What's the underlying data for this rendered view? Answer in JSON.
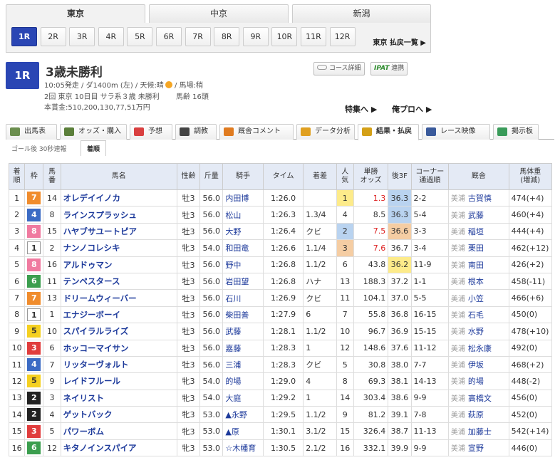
{
  "venues": [
    {
      "label": "東京",
      "active": true
    },
    {
      "label": "中京",
      "active": false
    },
    {
      "label": "新潟",
      "active": false
    }
  ],
  "race_buttons": [
    "1R",
    "2R",
    "3R",
    "4R",
    "5R",
    "6R",
    "7R",
    "8R",
    "9R",
    "10R",
    "11R",
    "12R"
  ],
  "payout_link": "東京 払戻一覧 ▶",
  "race": {
    "number": "1R",
    "title": "3歳未勝利",
    "line1a": "10:05発走 / ダ1400m (左) / 天候:晴",
    "line1b": " / 馬場:稍",
    "line2": "2回 東京 10日目 サラ系３歳 未勝利　　 馬齢 16頭",
    "line3": "本賞金:510,200,130,77,51万円"
  },
  "buttons": {
    "course": "コース詳細",
    "ipat_a": "IPAT",
    "ipat_b": "連携",
    "feature": "特集へ ▶",
    "orepro": "俺プロへ ▶"
  },
  "colors": {
    "brand": "#2a46b4",
    "header_bg": "#e4eaf5"
  },
  "nav_tabs": [
    {
      "label": "出馬表",
      "icon": "table-icon",
      "color": "#6b8e4e"
    },
    {
      "label": "オッズ・購入",
      "icon": "odds-icon",
      "color": "#5b7f3a"
    },
    {
      "label": "予想",
      "icon": "target-icon",
      "color": "#d94040"
    },
    {
      "label": "調教",
      "icon": "stopwatch-icon",
      "color": "#444444"
    },
    {
      "label": "厩舎コメント",
      "icon": "stable-icon",
      "color": "#e07b20"
    },
    {
      "label": "データ分析",
      "icon": "bar-chart-icon",
      "color": "#e0a020"
    },
    {
      "label": "結果・払戻",
      "icon": "coins-icon",
      "color": "#d4a017"
    },
    {
      "label": "レース映像",
      "icon": "video-icon",
      "color": "#3a5a9b"
    },
    {
      "label": "掲示板",
      "icon": "chat-icon",
      "color": "#3a9b5a"
    }
  ],
  "sub_tabs": {
    "goal": "ゴール後 30秒速報",
    "active": "着順"
  },
  "table": {
    "headers": [
      "着\n順",
      "枠",
      "馬\n番",
      "馬名",
      "性齢",
      "斤量",
      "騎手",
      "タイム",
      "着差",
      "人\n気",
      "単勝\nオッズ",
      "後3F",
      "コーナー\n通過順",
      "厩舎",
      "馬体重\n(増減)"
    ],
    "rows": [
      {
        "pos": "1",
        "waku": "7",
        "num": "14",
        "horse": "オレデイイノカ",
        "sex": "牡3",
        "wt": "56.0",
        "jockey": "内田博",
        "time": "1:26.0",
        "margin": "",
        "pop": "1",
        "odds": "1.3",
        "f3": "36.3",
        "corner": "2-2",
        "tr": "美浦",
        "trainer": "古賀慎",
        "bw": "474(+4)"
      },
      {
        "pos": "2",
        "waku": "4",
        "num": "8",
        "horse": "ラインスプラッシュ",
        "sex": "牡3",
        "wt": "56.0",
        "jockey": "松山",
        "time": "1:26.3",
        "margin": "1.3/4",
        "pop": "4",
        "odds": "8.5",
        "f3": "36.3",
        "corner": "5-4",
        "tr": "美浦",
        "trainer": "武藤",
        "bw": "460(+4)"
      },
      {
        "pos": "3",
        "waku": "8",
        "num": "15",
        "horse": "ハヤブサユートピア",
        "sex": "牡3",
        "wt": "56.0",
        "jockey": "大野",
        "time": "1:26.4",
        "margin": "クビ",
        "pop": "2",
        "odds": "7.5",
        "f3": "36.6",
        "corner": "3-3",
        "tr": "美浦",
        "trainer": "稲垣",
        "bw": "444(+4)"
      },
      {
        "pos": "4",
        "waku": "1",
        "num": "2",
        "horse": "ナンノコレシキ",
        "sex": "牝3",
        "wt": "54.0",
        "jockey": "和田竜",
        "time": "1:26.6",
        "margin": "1.1/4",
        "pop": "3",
        "odds": "7.6",
        "f3": "36.7",
        "corner": "3-4",
        "tr": "美浦",
        "trainer": "栗田",
        "bw": "462(+12)"
      },
      {
        "pos": "5",
        "waku": "8",
        "num": "16",
        "horse": "アルドゥマン",
        "sex": "牡3",
        "wt": "56.0",
        "jockey": "野中",
        "time": "1:26.8",
        "margin": "1.1/2",
        "pop": "6",
        "odds": "43.8",
        "f3": "36.2",
        "corner": "11-9",
        "tr": "美浦",
        "trainer": "南田",
        "bw": "426(+2)"
      },
      {
        "pos": "6",
        "waku": "6",
        "num": "11",
        "horse": "テンペスタース",
        "sex": "牡3",
        "wt": "56.0",
        "jockey": "岩田望",
        "time": "1:26.8",
        "margin": "ハナ",
        "pop": "13",
        "odds": "188.3",
        "f3": "37.2",
        "corner": "1-1",
        "tr": "美浦",
        "trainer": "根本",
        "bw": "458(-11)"
      },
      {
        "pos": "7",
        "waku": "7",
        "num": "13",
        "horse": "ドリームウィーバー",
        "sex": "牡3",
        "wt": "56.0",
        "jockey": "石川",
        "time": "1:26.9",
        "margin": "クビ",
        "pop": "11",
        "odds": "104.1",
        "f3": "37.0",
        "corner": "5-5",
        "tr": "美浦",
        "trainer": "小笠",
        "bw": "466(+6)"
      },
      {
        "pos": "8",
        "waku": "1",
        "num": "1",
        "horse": "エナジーボーイ",
        "sex": "牡3",
        "wt": "56.0",
        "jockey": "柴田善",
        "time": "1:27.9",
        "margin": "6",
        "pop": "7",
        "odds": "55.8",
        "f3": "36.8",
        "corner": "16-15",
        "tr": "美浦",
        "trainer": "石毛",
        "bw": "450(0)"
      },
      {
        "pos": "9",
        "waku": "5",
        "num": "10",
        "horse": "スパイラルライズ",
        "sex": "牡3",
        "wt": "56.0",
        "jockey": "武藤",
        "time": "1:28.1",
        "margin": "1.1/2",
        "pop": "10",
        "odds": "96.7",
        "f3": "36.9",
        "corner": "15-15",
        "tr": "美浦",
        "trainer": "水野",
        "bw": "478(+10)"
      },
      {
        "pos": "10",
        "waku": "3",
        "num": "6",
        "horse": "ホッコーマイサン",
        "sex": "牡3",
        "wt": "56.0",
        "jockey": "嘉藤",
        "time": "1:28.3",
        "margin": "1",
        "pop": "12",
        "odds": "148.6",
        "f3": "37.6",
        "corner": "11-12",
        "tr": "美浦",
        "trainer": "松永康",
        "bw": "492(0)"
      },
      {
        "pos": "11",
        "waku": "4",
        "num": "7",
        "horse": "リッターヴォルト",
        "sex": "牡3",
        "wt": "56.0",
        "jockey": "三浦",
        "time": "1:28.3",
        "margin": "クビ",
        "pop": "5",
        "odds": "30.8",
        "f3": "38.0",
        "corner": "7-7",
        "tr": "美浦",
        "trainer": "伊坂",
        "bw": "468(+2)"
      },
      {
        "pos": "12",
        "waku": "5",
        "num": "9",
        "horse": "レイドフルール",
        "sex": "牝3",
        "wt": "54.0",
        "jockey": "的場",
        "time": "1:29.0",
        "margin": "4",
        "pop": "8",
        "odds": "69.3",
        "f3": "38.1",
        "corner": "14-13",
        "tr": "美浦",
        "trainer": "的場",
        "bw": "448(-2)"
      },
      {
        "pos": "13",
        "waku": "2",
        "num": "3",
        "horse": "ネイリスト",
        "sex": "牝3",
        "wt": "54.0",
        "jockey": "大庭",
        "time": "1:29.2",
        "margin": "1",
        "pop": "14",
        "odds": "303.4",
        "f3": "38.6",
        "corner": "9-9",
        "tr": "美浦",
        "trainer": "高橋文",
        "bw": "456(0)"
      },
      {
        "pos": "14",
        "waku": "2",
        "num": "4",
        "horse": "ゲットバック",
        "sex": "牝3",
        "wt": "53.0",
        "jockey": "▲永野",
        "time": "1:29.5",
        "margin": "1.1/2",
        "pop": "9",
        "odds": "81.2",
        "f3": "39.1",
        "corner": "7-8",
        "tr": "美浦",
        "trainer": "萩原",
        "bw": "452(0)"
      },
      {
        "pos": "15",
        "waku": "3",
        "num": "5",
        "horse": "パワーボム",
        "sex": "牝3",
        "wt": "53.0",
        "jockey": "▲原",
        "time": "1:30.1",
        "margin": "3.1/2",
        "pop": "15",
        "odds": "326.4",
        "f3": "38.7",
        "corner": "11-13",
        "tr": "美浦",
        "trainer": "加藤士",
        "bw": "542(+14)"
      },
      {
        "pos": "16",
        "waku": "6",
        "num": "12",
        "horse": "キタノインスパイア",
        "sex": "牝3",
        "wt": "53.0",
        "jockey": "☆木幡育",
        "time": "1:30.5",
        "margin": "2.1/2",
        "pop": "16",
        "odds": "332.1",
        "f3": "39.9",
        "corner": "9-9",
        "tr": "美浦",
        "trainer": "宣野",
        "bw": "446(0)"
      }
    ]
  }
}
